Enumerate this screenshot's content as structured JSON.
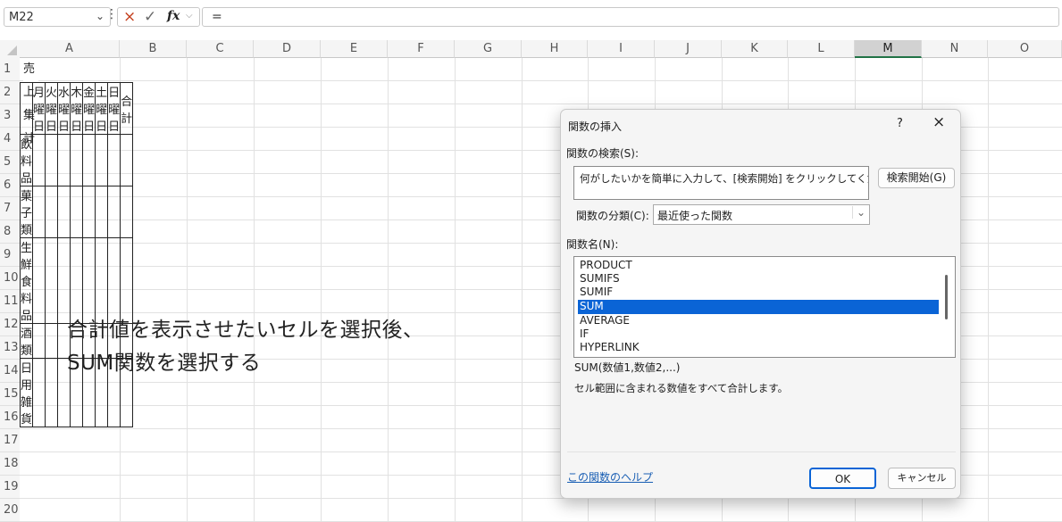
{
  "formula_bar": {
    "name_box": "M22",
    "separator": "⋮",
    "cancel_icon": "×",
    "enter_icon": "✓",
    "fx_label": "fx",
    "formula": "="
  },
  "columns": [
    "A",
    "B",
    "C",
    "D",
    "E",
    "F",
    "G",
    "H",
    "I",
    "J",
    "K",
    "L",
    "M",
    "N",
    "O"
  ],
  "selected_column": "M",
  "rows": [
    "1",
    "2",
    "3",
    "4",
    "5",
    "6",
    "7",
    "8",
    "9",
    "10",
    "11",
    "12",
    "13",
    "14",
    "15",
    "16",
    "17",
    "18",
    "19",
    "20"
  ],
  "sheet": {
    "a1": "売上集計",
    "header_row": [
      "月曜日",
      "火曜日",
      "水曜日",
      "木曜日",
      "金曜日",
      "土曜日",
      "日曜日",
      "合計"
    ],
    "categories": [
      "飲料品",
      "菓子類",
      "生鮮食料品",
      "酒類",
      "日用雑貨"
    ],
    "note_line1": "合計値を表示させたいセルを選択後、",
    "note_line2": "SUM関数を選択する"
  },
  "dialog": {
    "title": "関数の挿入",
    "help": "?",
    "close": "×",
    "search_label": "関数の検索(S):",
    "search_value": "何がしたいかを簡単に入力して、[検索開始] をクリックしてください。",
    "search_button": "検索開始(G)",
    "category_label": "関数の分類(C):",
    "category_value": "最近使った関数",
    "function_label": "関数名(N):",
    "functions": [
      "PRODUCT",
      "SUMIFS",
      "SUMIF",
      "SUM",
      "AVERAGE",
      "IF",
      "HYPERLINK"
    ],
    "selected_function": "SUM",
    "signature": "SUM(数値1,数値2,...)",
    "description": "セル範囲に含まれる数値をすべて合計します。",
    "help_link": "この関数のヘルプ",
    "ok": "OK",
    "cancel": "キャンセル"
  }
}
